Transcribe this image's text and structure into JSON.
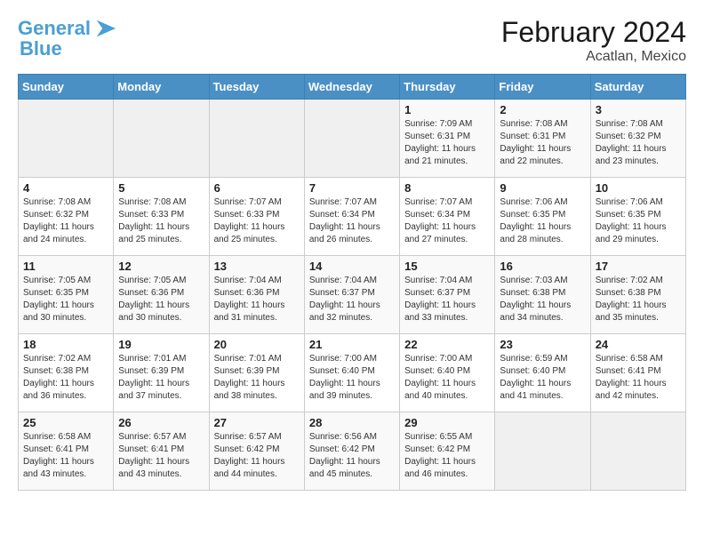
{
  "header": {
    "logo_line1": "General",
    "logo_line2": "Blue",
    "month_year": "February 2024",
    "location": "Acatlan, Mexico"
  },
  "weekdays": [
    "Sunday",
    "Monday",
    "Tuesday",
    "Wednesday",
    "Thursday",
    "Friday",
    "Saturday"
  ],
  "weeks": [
    [
      {
        "day": "",
        "info": ""
      },
      {
        "day": "",
        "info": ""
      },
      {
        "day": "",
        "info": ""
      },
      {
        "day": "",
        "info": ""
      },
      {
        "day": "1",
        "info": "Sunrise: 7:09 AM\nSunset: 6:31 PM\nDaylight: 11 hours\nand 21 minutes."
      },
      {
        "day": "2",
        "info": "Sunrise: 7:08 AM\nSunset: 6:31 PM\nDaylight: 11 hours\nand 22 minutes."
      },
      {
        "day": "3",
        "info": "Sunrise: 7:08 AM\nSunset: 6:32 PM\nDaylight: 11 hours\nand 23 minutes."
      }
    ],
    [
      {
        "day": "4",
        "info": "Sunrise: 7:08 AM\nSunset: 6:32 PM\nDaylight: 11 hours\nand 24 minutes."
      },
      {
        "day": "5",
        "info": "Sunrise: 7:08 AM\nSunset: 6:33 PM\nDaylight: 11 hours\nand 25 minutes."
      },
      {
        "day": "6",
        "info": "Sunrise: 7:07 AM\nSunset: 6:33 PM\nDaylight: 11 hours\nand 25 minutes."
      },
      {
        "day": "7",
        "info": "Sunrise: 7:07 AM\nSunset: 6:34 PM\nDaylight: 11 hours\nand 26 minutes."
      },
      {
        "day": "8",
        "info": "Sunrise: 7:07 AM\nSunset: 6:34 PM\nDaylight: 11 hours\nand 27 minutes."
      },
      {
        "day": "9",
        "info": "Sunrise: 7:06 AM\nSunset: 6:35 PM\nDaylight: 11 hours\nand 28 minutes."
      },
      {
        "day": "10",
        "info": "Sunrise: 7:06 AM\nSunset: 6:35 PM\nDaylight: 11 hours\nand 29 minutes."
      }
    ],
    [
      {
        "day": "11",
        "info": "Sunrise: 7:05 AM\nSunset: 6:35 PM\nDaylight: 11 hours\nand 30 minutes."
      },
      {
        "day": "12",
        "info": "Sunrise: 7:05 AM\nSunset: 6:36 PM\nDaylight: 11 hours\nand 30 minutes."
      },
      {
        "day": "13",
        "info": "Sunrise: 7:04 AM\nSunset: 6:36 PM\nDaylight: 11 hours\nand 31 minutes."
      },
      {
        "day": "14",
        "info": "Sunrise: 7:04 AM\nSunset: 6:37 PM\nDaylight: 11 hours\nand 32 minutes."
      },
      {
        "day": "15",
        "info": "Sunrise: 7:04 AM\nSunset: 6:37 PM\nDaylight: 11 hours\nand 33 minutes."
      },
      {
        "day": "16",
        "info": "Sunrise: 7:03 AM\nSunset: 6:38 PM\nDaylight: 11 hours\nand 34 minutes."
      },
      {
        "day": "17",
        "info": "Sunrise: 7:02 AM\nSunset: 6:38 PM\nDaylight: 11 hours\nand 35 minutes."
      }
    ],
    [
      {
        "day": "18",
        "info": "Sunrise: 7:02 AM\nSunset: 6:38 PM\nDaylight: 11 hours\nand 36 minutes."
      },
      {
        "day": "19",
        "info": "Sunrise: 7:01 AM\nSunset: 6:39 PM\nDaylight: 11 hours\nand 37 minutes."
      },
      {
        "day": "20",
        "info": "Sunrise: 7:01 AM\nSunset: 6:39 PM\nDaylight: 11 hours\nand 38 minutes."
      },
      {
        "day": "21",
        "info": "Sunrise: 7:00 AM\nSunset: 6:40 PM\nDaylight: 11 hours\nand 39 minutes."
      },
      {
        "day": "22",
        "info": "Sunrise: 7:00 AM\nSunset: 6:40 PM\nDaylight: 11 hours\nand 40 minutes."
      },
      {
        "day": "23",
        "info": "Sunrise: 6:59 AM\nSunset: 6:40 PM\nDaylight: 11 hours\nand 41 minutes."
      },
      {
        "day": "24",
        "info": "Sunrise: 6:58 AM\nSunset: 6:41 PM\nDaylight: 11 hours\nand 42 minutes."
      }
    ],
    [
      {
        "day": "25",
        "info": "Sunrise: 6:58 AM\nSunset: 6:41 PM\nDaylight: 11 hours\nand 43 minutes."
      },
      {
        "day": "26",
        "info": "Sunrise: 6:57 AM\nSunset: 6:41 PM\nDaylight: 11 hours\nand 43 minutes."
      },
      {
        "day": "27",
        "info": "Sunrise: 6:57 AM\nSunset: 6:42 PM\nDaylight: 11 hours\nand 44 minutes."
      },
      {
        "day": "28",
        "info": "Sunrise: 6:56 AM\nSunset: 6:42 PM\nDaylight: 11 hours\nand 45 minutes."
      },
      {
        "day": "29",
        "info": "Sunrise: 6:55 AM\nSunset: 6:42 PM\nDaylight: 11 hours\nand 46 minutes."
      },
      {
        "day": "",
        "info": ""
      },
      {
        "day": "",
        "info": ""
      }
    ]
  ]
}
